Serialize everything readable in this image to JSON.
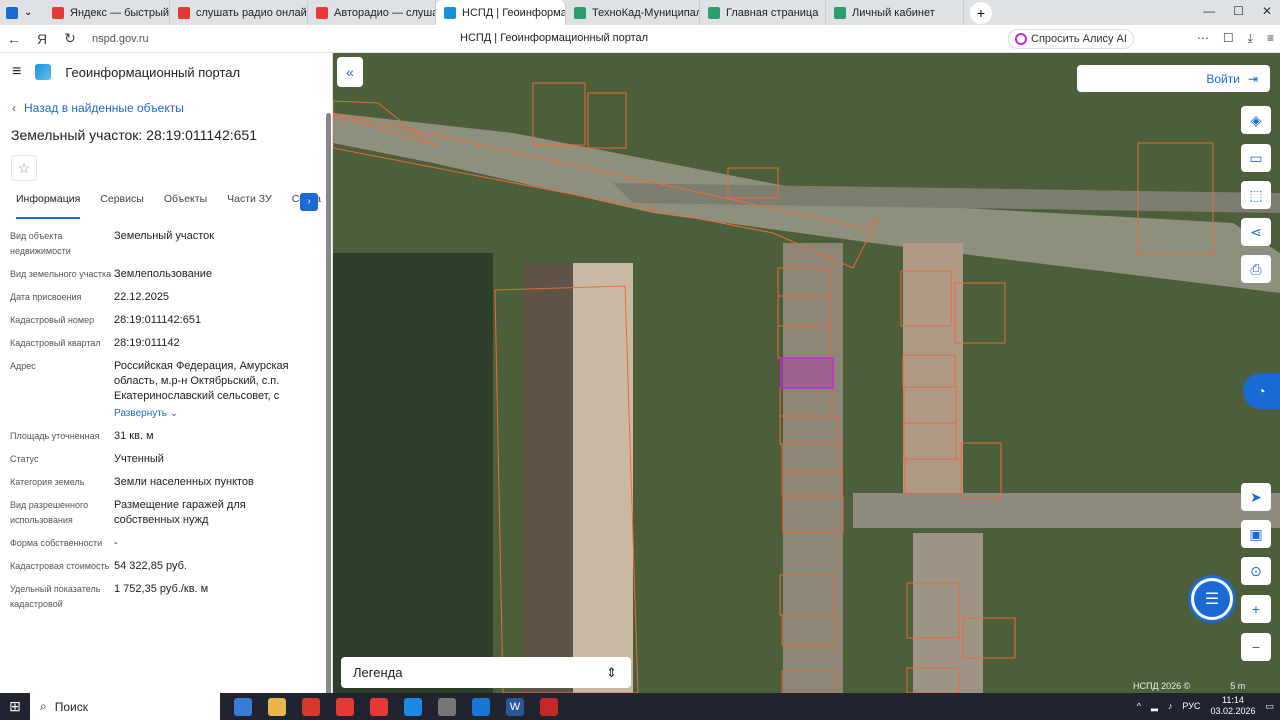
{
  "browser": {
    "tabs": [
      {
        "label": "Яндекс — быстрый поиск",
        "color": "#e53935",
        "active": false
      },
      {
        "label": "слушать радио онлайн —",
        "color": "#e53935",
        "active": false
      },
      {
        "label": "Авторадио — слуша",
        "color": "#e53935",
        "active": false
      },
      {
        "label": "НСПД | Геоинформац",
        "color": "#1a8fd6",
        "active": true
      },
      {
        "label": "ТехноКад-Муниципалит",
        "color": "#2e9e6e",
        "active": false
      },
      {
        "label": "Главная страница",
        "color": "#2e9e6e",
        "active": false
      },
      {
        "label": "Личный кабинет",
        "color": "#2e9e6e",
        "active": false
      }
    ],
    "url": "nspd.gov.ru",
    "page_title": "НСПД | Геоинформационный портал",
    "alice_label": "Спросить Алису AI"
  },
  "panel": {
    "app_title": "Геоинформационный портал",
    "back_label": "Назад в найденные объекты",
    "object_title": "Земельный участок: 28:19:011142:651",
    "tabs": [
      "Информация",
      "Сервисы",
      "Объекты",
      "Части ЗУ",
      "Соста"
    ],
    "rows": [
      {
        "label": "Вид объекта недвижимости",
        "value": "Земельный участок"
      },
      {
        "label": "Вид земельного участка",
        "value": "Землепользование"
      },
      {
        "label": "Дата присвоения",
        "value": "22.12.2025"
      },
      {
        "label": "Кадастровый номер",
        "value": "28:19:011142:651"
      },
      {
        "label": "Кадастровый квартал",
        "value": "28:19:011142"
      },
      {
        "label": "Адрес",
        "value": "Российская Федерация, Амурская область, м.р-н Октябрьский, с.п. Екатеринославский сельсовет, с"
      },
      {
        "label": "Площадь уточненная",
        "value": "31 кв. м"
      },
      {
        "label": "Статус",
        "value": "Учтенный"
      },
      {
        "label": "Категория земель",
        "value": "Земли населенных пунктов"
      },
      {
        "label": "Вид разрешенного использования",
        "value": "Размещение гаражей для собственных нужд"
      },
      {
        "label": "Форма собственности",
        "value": "-"
      },
      {
        "label": "Кадастровая стоимость",
        "value": "54 322,85 руб."
      },
      {
        "label": "Удельный показатель кадастровой",
        "value": "1 752,35 руб./кв. м"
      }
    ],
    "expand_label": "Развернуть"
  },
  "map": {
    "login_label": "Войти",
    "legend_label": "Легенда",
    "scale_label": "5 m",
    "copyright": "НСПД 2026 ©"
  },
  "taskbar": {
    "search_label": "Поиск",
    "lang": "РУС",
    "time": "11:14",
    "date": "03.02.2026"
  }
}
